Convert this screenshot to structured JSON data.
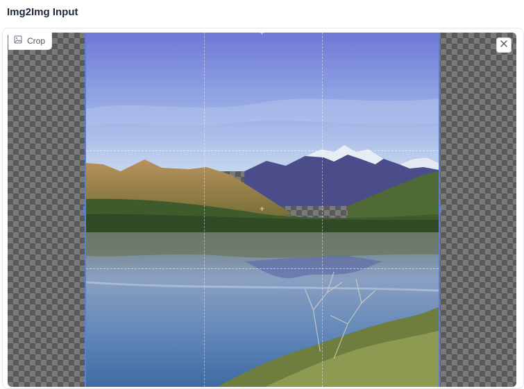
{
  "header": {
    "title": "Img2Img Input"
  },
  "toolbar": {
    "crop_label": "Crop",
    "crop_icon": "image-icon",
    "close_icon": "close-icon"
  },
  "colors": {
    "crop_frame": "#5b7fd8",
    "checker_dark": "#5a5a5a",
    "checker_light": "#7a7a7a"
  }
}
